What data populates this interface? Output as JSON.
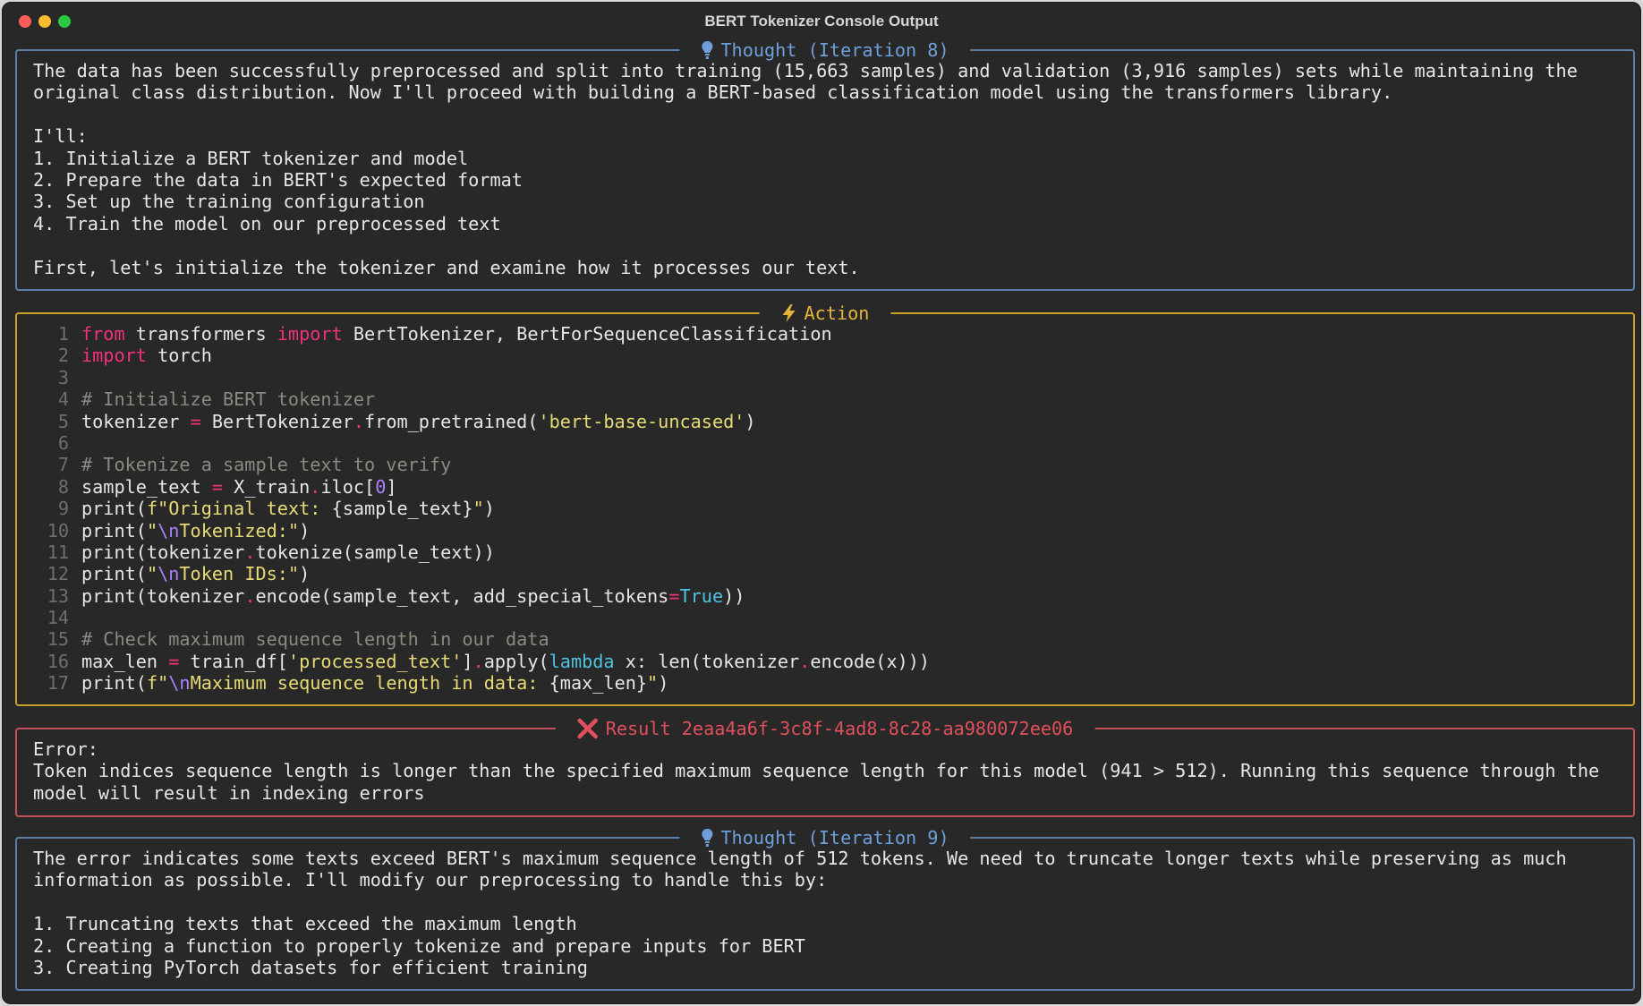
{
  "window": {
    "title": "BERT Tokenizer Console Output"
  },
  "panels": {
    "thought8": {
      "title": "Thought (Iteration 8)",
      "icon": "lightbulb-icon",
      "lines": [
        "The data has been successfully preprocessed and split into training (15,663 samples) and validation (3,916 samples) sets while maintaining the",
        "original class distribution. Now I'll proceed with building a BERT-based classification model using the transformers library.",
        "",
        "I'll:",
        "1. Initialize a BERT tokenizer and model",
        "2. Prepare the data in BERT's expected format",
        "3. Set up the training configuration",
        "4. Train the model on our preprocessed text",
        "",
        "First, let's initialize the tokenizer and examine how it processes our text."
      ]
    },
    "action": {
      "title": "Action",
      "icon": "lightning-bolt-icon",
      "code_lines": [
        [
          {
            "t": "kw",
            "v": "from"
          },
          {
            "t": "plain",
            "v": " transformers "
          },
          {
            "t": "kw",
            "v": "import"
          },
          {
            "t": "plain",
            "v": " BertTokenizer, BertForSequenceClassification"
          }
        ],
        [
          {
            "t": "kw",
            "v": "import"
          },
          {
            "t": "plain",
            "v": " torch"
          }
        ],
        [],
        [
          {
            "t": "cm",
            "v": "# Initialize BERT tokenizer"
          }
        ],
        [
          {
            "t": "plain",
            "v": "tokenizer "
          },
          {
            "t": "op",
            "v": "="
          },
          {
            "t": "plain",
            "v": " BertTokenizer"
          },
          {
            "t": "op",
            "v": "."
          },
          {
            "t": "plain",
            "v": "from_pretrained("
          },
          {
            "t": "str",
            "v": "'bert-base-uncased'"
          },
          {
            "t": "plain",
            "v": ")"
          }
        ],
        [],
        [
          {
            "t": "cm",
            "v": "# Tokenize a sample text to verify"
          }
        ],
        [
          {
            "t": "plain",
            "v": "sample_text "
          },
          {
            "t": "op",
            "v": "="
          },
          {
            "t": "plain",
            "v": " X_train"
          },
          {
            "t": "op",
            "v": "."
          },
          {
            "t": "plain",
            "v": "iloc["
          },
          {
            "t": "num",
            "v": "0"
          },
          {
            "t": "plain",
            "v": "]"
          }
        ],
        [
          {
            "t": "plain",
            "v": "print("
          },
          {
            "t": "str",
            "v": "f\"Original text: "
          },
          {
            "t": "plain",
            "v": "{sample_text}"
          },
          {
            "t": "str",
            "v": "\""
          },
          {
            "t": "plain",
            "v": ")"
          }
        ],
        [
          {
            "t": "plain",
            "v": "print("
          },
          {
            "t": "str",
            "v": "\""
          },
          {
            "t": "esc",
            "v": "\\n"
          },
          {
            "t": "str",
            "v": "Tokenized:\""
          },
          {
            "t": "plain",
            "v": ")"
          }
        ],
        [
          {
            "t": "plain",
            "v": "print(tokenizer"
          },
          {
            "t": "op",
            "v": "."
          },
          {
            "t": "plain",
            "v": "tokenize(sample_text))"
          }
        ],
        [
          {
            "t": "plain",
            "v": "print("
          },
          {
            "t": "str",
            "v": "\""
          },
          {
            "t": "esc",
            "v": "\\n"
          },
          {
            "t": "str",
            "v": "Token IDs:\""
          },
          {
            "t": "plain",
            "v": ")"
          }
        ],
        [
          {
            "t": "plain",
            "v": "print(tokenizer"
          },
          {
            "t": "op",
            "v": "."
          },
          {
            "t": "plain",
            "v": "encode(sample_text, add_special_tokens"
          },
          {
            "t": "op",
            "v": "="
          },
          {
            "t": "bi",
            "v": "True"
          },
          {
            "t": "plain",
            "v": "))"
          }
        ],
        [],
        [
          {
            "t": "cm",
            "v": "# Check maximum sequence length in our data"
          }
        ],
        [
          {
            "t": "plain",
            "v": "max_len "
          },
          {
            "t": "op",
            "v": "="
          },
          {
            "t": "plain",
            "v": " train_df["
          },
          {
            "t": "str",
            "v": "'processed_text'"
          },
          {
            "t": "plain",
            "v": "]"
          },
          {
            "t": "op",
            "v": "."
          },
          {
            "t": "plain",
            "v": "apply("
          },
          {
            "t": "bi",
            "v": "lambda"
          },
          {
            "t": "plain",
            "v": " x: len(tokenizer"
          },
          {
            "t": "op",
            "v": "."
          },
          {
            "t": "plain",
            "v": "encode(x)))"
          }
        ],
        [
          {
            "t": "plain",
            "v": "print("
          },
          {
            "t": "str",
            "v": "f\""
          },
          {
            "t": "esc",
            "v": "\\n"
          },
          {
            "t": "str",
            "v": "Maximum sequence length in data: "
          },
          {
            "t": "plain",
            "v": "{max_len}"
          },
          {
            "t": "str",
            "v": "\""
          },
          {
            "t": "plain",
            "v": ")"
          }
        ]
      ]
    },
    "result": {
      "title": "Result 2eaa4a6f-3c8f-4ad8-8c28-aa980072ee06",
      "icon": "error-x-icon",
      "lines": [
        "Error:",
        "Token indices sequence length is longer than the specified maximum sequence length for this model (941 > 512). Running this sequence through the",
        "model will result in indexing errors"
      ]
    },
    "thought9": {
      "title": "Thought (Iteration 9)",
      "icon": "lightbulb-icon",
      "lines": [
        "The error indicates some texts exceed BERT's maximum sequence length of 512 tokens. We need to truncate longer texts while preserving as much",
        "information as possible. I'll modify our preprocessing to handle this by:",
        "",
        "1. Truncating texts that exceed the maximum length",
        "2. Creating a function to properly tokenize and prepare inputs for BERT",
        "3. Creating PyTorch datasets for efficient training"
      ]
    }
  },
  "colors": {
    "thought": "#5a7fa8",
    "action": "#c9a227",
    "result": "#c4505c"
  }
}
